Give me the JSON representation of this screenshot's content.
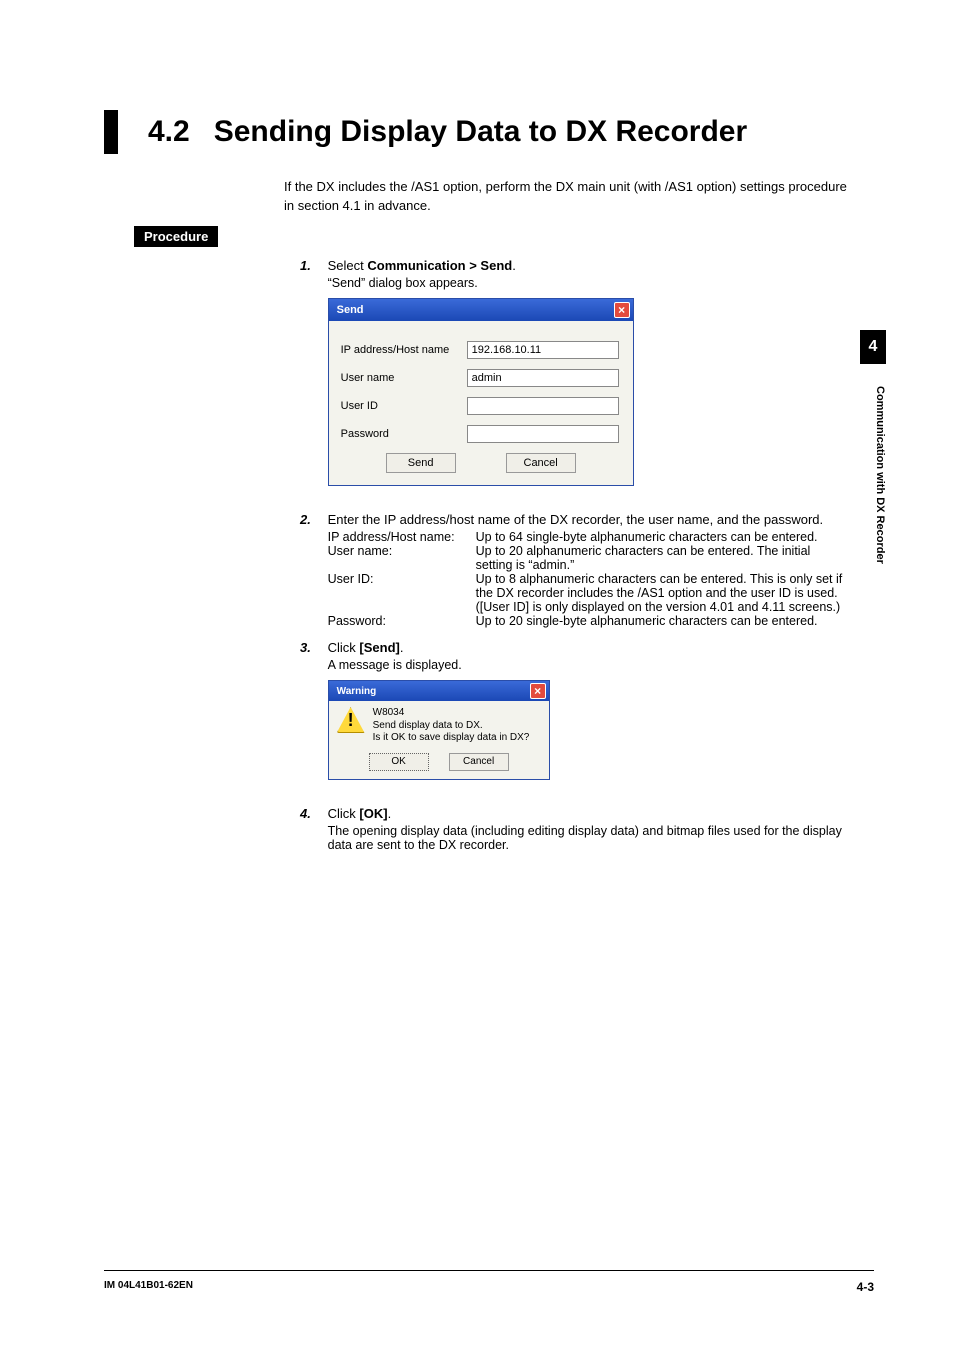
{
  "heading": {
    "number": "4.2",
    "title": "Sending Display Data to DX Recorder"
  },
  "intro": "If the DX includes the /AS1 option, perform the DX main unit (with /AS1 option) settings procedure in section 4.1 in advance.",
  "procedure_label": "Procedure",
  "steps": {
    "s1": {
      "num": "1.",
      "line_a": "Select ",
      "line_b_bold": "Communication > Send",
      "line_c": ".",
      "sub": "“Send” dialog box appears."
    },
    "s2": {
      "num": "2.",
      "text": "Enter the IP address/host name of the DX recorder, the user name, and the password.",
      "defs": {
        "ip_label": "IP address/Host name:",
        "ip_desc": "Up to 64 single-byte alphanumeric characters can be entered.",
        "un_label": "User name:",
        "un_desc": "Up to 20 alphanumeric characters can be entered. The initial setting is “admin.”",
        "uid_label": "User ID:",
        "uid_desc": "Up to 8 alphanumeric characters can be entered. This is only set if the DX recorder includes the /AS1 option and the user ID is used. ([User ID] is only displayed on the version 4.01 and 4.11 screens.)",
        "pw_label": "Password:",
        "pw_desc": "Up to 20 single-byte alphanumeric characters can be entered."
      }
    },
    "s3": {
      "num": "3.",
      "line_a": "Click ",
      "line_b_bold": "[Send]",
      "line_c": ".",
      "sub": "A message is displayed."
    },
    "s4": {
      "num": "4.",
      "line_a": "Click ",
      "line_b_bold": "[OK]",
      "line_c": ".",
      "sub": "The opening display data (including editing display data) and bitmap files used for the display data are sent to the DX recorder."
    }
  },
  "send_dialog": {
    "title": "Send",
    "close": "×",
    "rows": {
      "ip_label": "IP address/Host name",
      "ip_value": "192.168.10.11",
      "un_label": "User name",
      "un_value": "admin",
      "uid_label": "User ID",
      "uid_value": "",
      "pw_label": "Password",
      "pw_value": ""
    },
    "buttons": {
      "send": "Send",
      "cancel": "Cancel"
    }
  },
  "warning_dialog": {
    "title": "Warning",
    "close": "×",
    "code": "W8034",
    "line1": "Send display data to DX.",
    "line2": "Is it OK to save display data in DX?",
    "buttons": {
      "ok": "OK",
      "cancel": "Cancel"
    }
  },
  "side": {
    "chapter": "4",
    "label": "Communication with DX Recorder"
  },
  "footer": {
    "left": "IM 04L41B01-62EN",
    "right": "4-3"
  }
}
